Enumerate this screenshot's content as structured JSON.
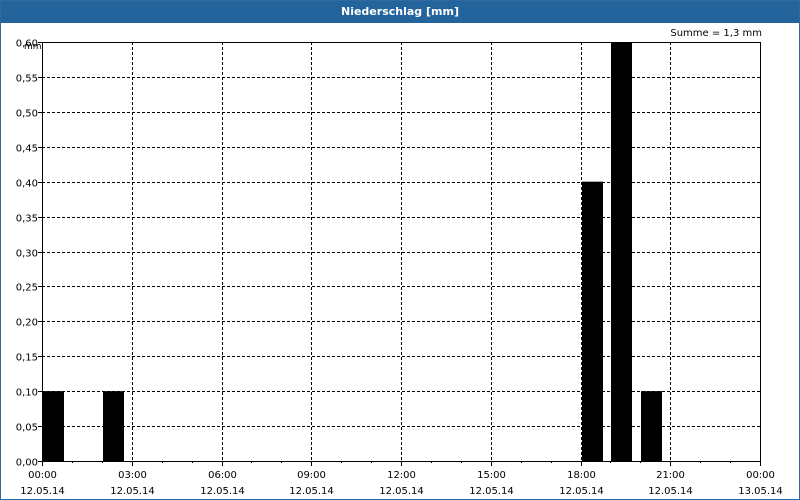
{
  "window": {
    "title": "Niederschlag [mm]"
  },
  "summary": {
    "text": "Summe = 1,3 mm"
  },
  "colors": {
    "titlebar": "#23649c",
    "bar": "#000000",
    "grid": "#000000"
  },
  "chart_data": {
    "type": "bar",
    "ylabel": "mm",
    "ylim": [
      0,
      0.6
    ],
    "yticks": [
      "0,00",
      "0,05",
      "0,10",
      "0,15",
      "0,20",
      "0,25",
      "0,30",
      "0,35",
      "0,40",
      "0,45",
      "0,50",
      "0,55",
      "0,60"
    ],
    "xlim": [
      "12.05.14 00:00",
      "13.05.14 00:00"
    ],
    "xticks": [
      {
        "time": "00:00",
        "date": "12.05.14"
      },
      {
        "time": "03:00",
        "date": "12.05.14"
      },
      {
        "time": "06:00",
        "date": "12.05.14"
      },
      {
        "time": "09:00",
        "date": "12.05.14"
      },
      {
        "time": "12:00",
        "date": "12.05.14"
      },
      {
        "time": "15:00",
        "date": "12.05.14"
      },
      {
        "time": "18:00",
        "date": "12.05.14"
      },
      {
        "time": "21:00",
        "date": "12.05.14"
      },
      {
        "time": "00:00",
        "date": "13.05.14"
      }
    ],
    "bars": [
      {
        "time": "12.05.14 00:00",
        "value": 0.1
      },
      {
        "time": "12.05.14 02:00",
        "value": 0.1
      },
      {
        "time": "12.05.14 18:00",
        "value": 0.4
      },
      {
        "time": "12.05.14 19:00",
        "value": 0.6
      },
      {
        "time": "12.05.14 20:00",
        "value": 0.1
      }
    ],
    "grid": true
  }
}
